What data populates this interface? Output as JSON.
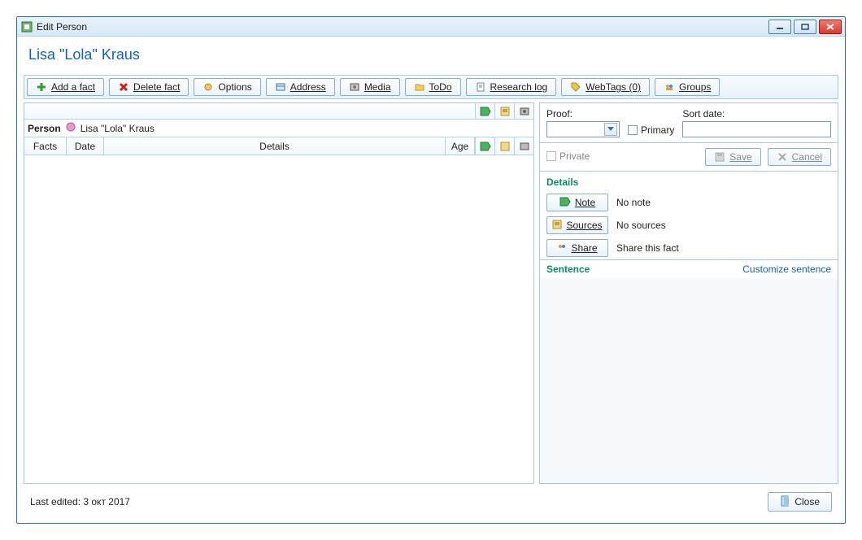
{
  "window": {
    "title": "Edit Person"
  },
  "person_display": "Lisa \"Lola\" Kraus",
  "toolbar": {
    "add": "Add a fact",
    "delete": "Delete fact",
    "options": "Options",
    "address": "Address",
    "media": "Media",
    "todo": "ToDo",
    "research": "Research log",
    "webtags": "WebTags (0)",
    "groups": "Groups"
  },
  "left": {
    "person_label": "Person",
    "person_value": "Lisa \"Lola\" Kraus",
    "cols": {
      "facts": "Facts",
      "date": "Date",
      "details": "Details",
      "age": "Age"
    }
  },
  "right": {
    "proof_label": "Proof:",
    "primary_label": "Primary",
    "sortdate_label": "Sort date:",
    "private_label": "Private",
    "save": "Save",
    "cancel": "Cancel",
    "details_head": "Details",
    "note_btn": "Note",
    "note_text": "No  note",
    "sources_btn": "Sources",
    "sources_text": "No  sources",
    "share_btn": "Share",
    "share_text": "Share this fact",
    "sentence_head": "Sentence",
    "customize": "Customize sentence"
  },
  "footer": {
    "last_edited": "Last edited: 3 окт 2017",
    "close": "Close"
  }
}
